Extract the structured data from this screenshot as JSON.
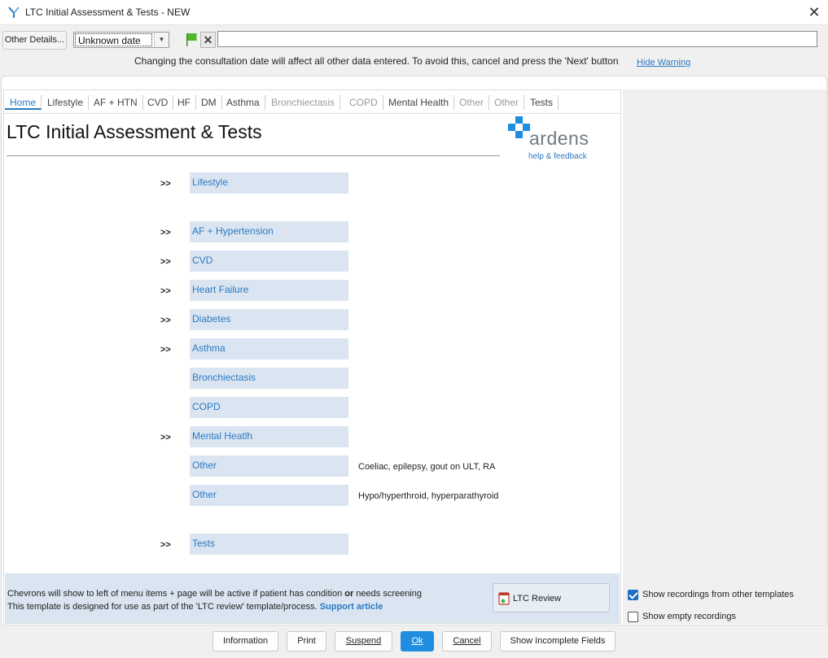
{
  "window": {
    "title": "LTC Initial Assessment & Tests - NEW",
    "close_glyph": "✕"
  },
  "toolbar": {
    "other_details_label": "Other Details...",
    "date_value": "Unknown date",
    "date_arrow": "▼",
    "clear_glyph": "✕",
    "notes_value": "",
    "warning_text": "Changing the consultation date will affect all other data entered. To avoid this, cancel and press the 'Next' button",
    "hide_warning_label": "Hide Warning"
  },
  "tabs": [
    {
      "label": "Home"
    },
    {
      "label": "Lifestyle"
    },
    {
      "label": "AF + HTN"
    },
    {
      "label": "CVD"
    },
    {
      "label": "HF"
    },
    {
      "label": "DM"
    },
    {
      "label": "Asthma"
    },
    {
      "label": "Bronchiectasis"
    },
    {
      "label": "COPD"
    },
    {
      "label": "Mental Health"
    },
    {
      "label": "Other"
    },
    {
      "label": "Other"
    },
    {
      "label": "Tests"
    }
  ],
  "page": {
    "title": "LTC Initial Assessment & Tests",
    "logo_word": "ardens",
    "logo_sub": "help & feedback"
  },
  "menu": {
    "chevron": ">>",
    "items": [
      {
        "label": "Lifestyle",
        "note": ""
      },
      {
        "label": "AF + Hypertension",
        "note": ""
      },
      {
        "label": "CVD",
        "note": ""
      },
      {
        "label": "Heart Failure",
        "note": ""
      },
      {
        "label": "Diabetes",
        "note": ""
      },
      {
        "label": "Asthma",
        "note": ""
      },
      {
        "label": "Bronchiectasis",
        "note": ""
      },
      {
        "label": "COPD",
        "note": ""
      },
      {
        "label": "Mental Heatlh",
        "note": ""
      },
      {
        "label": "Other",
        "note": "Coeliac, epilepsy, gout on ULT, RA"
      },
      {
        "label": "Other",
        "note": "Hypo/hyperthroid, hyperparathyroid"
      },
      {
        "label": "Tests",
        "note": ""
      }
    ]
  },
  "footer": {
    "line1_a": "Chevrons will show to left of menu items + page will be active if patient has condition ",
    "line1_or": "or",
    "line1_b": " needs screening",
    "line2": "This template is designed for use as part of the 'LTC review' template/process. ",
    "support_label": "Support article",
    "ltc_review_label": "LTC Review"
  },
  "side": {
    "show_other_label": "Show recordings from other templates",
    "show_other_checked": true,
    "show_empty_label": "Show empty recordings",
    "show_empty_checked": false
  },
  "buttons": {
    "information": "Information",
    "print": "Print",
    "suspend": "Suspend",
    "ok": "Ok",
    "cancel": "Cancel",
    "show_incomplete": "Show Incomplete Fields"
  },
  "colors": {
    "accent": "#2b79c2",
    "menu_bg": "#dae5f1",
    "ok_bg": "#1f8ee0",
    "logo_blue": "#1f8ee0"
  }
}
